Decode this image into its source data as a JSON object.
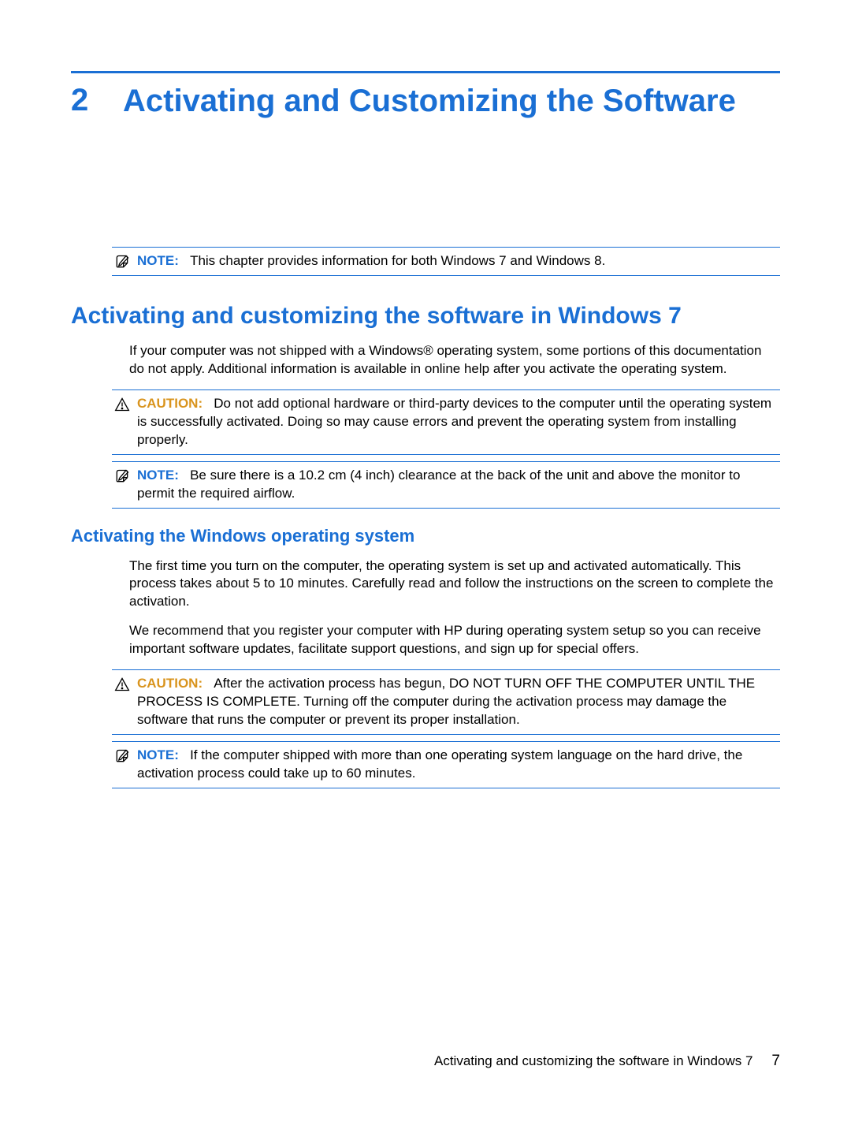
{
  "chapter": {
    "number": "2",
    "title": "Activating and Customizing the Software"
  },
  "intro_note": {
    "label": "NOTE:",
    "text": "This chapter provides information for both Windows 7 and Windows 8."
  },
  "section1": {
    "heading": "Activating and customizing the software in Windows 7",
    "para1": "If your computer was not shipped with a Windows® operating system, some portions of this documentation do not apply. Additional information is available in online help after you activate the operating system.",
    "caution1": {
      "label": "CAUTION:",
      "text": "Do not add optional hardware or third-party devices to the computer until the operating system is successfully activated. Doing so may cause errors and prevent the operating system from installing properly."
    },
    "note1": {
      "label": "NOTE:",
      "text": "Be sure there is a 10.2 cm (4 inch) clearance at the back of the unit and above the monitor to permit the required airflow."
    }
  },
  "section2": {
    "heading": "Activating the Windows operating system",
    "para1": "The first time you turn on the computer, the operating system is set up and activated automatically. This process takes about 5 to 10 minutes. Carefully read and follow the instructions on the screen to complete the activation.",
    "para2": "We recommend that you register your computer with HP during operating system setup so you can receive important software updates, facilitate support questions, and sign up for special offers.",
    "caution1": {
      "label": "CAUTION:",
      "text": "After the activation process has begun, DO NOT TURN OFF THE COMPUTER UNTIL THE PROCESS IS COMPLETE. Turning off the computer during the activation process may damage the software that runs the computer or prevent its proper installation."
    },
    "note1": {
      "label": "NOTE:",
      "text": "If the computer shipped with more than one operating system language on the hard drive, the activation process could take up to 60 minutes."
    }
  },
  "footer": {
    "text": "Activating and customizing the software in Windows 7",
    "page": "7"
  }
}
